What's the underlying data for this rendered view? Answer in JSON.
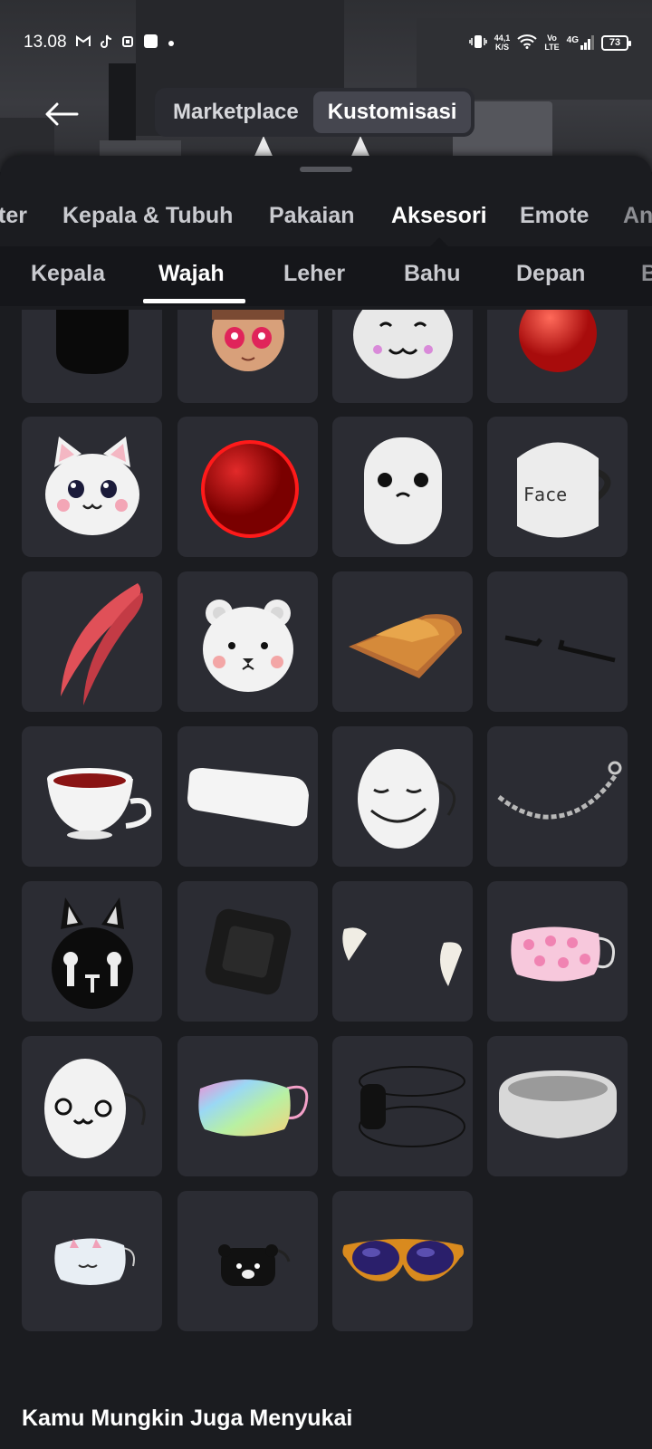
{
  "status_bar": {
    "time": "13.08",
    "net_speed_value": "44,1",
    "net_speed_unit": "K/S",
    "volte_top": "Vo",
    "volte_bottom": "LTE",
    "network": "4G",
    "battery": "73"
  },
  "top_nav": {
    "tabs": [
      {
        "label": "Marketplace",
        "active": false
      },
      {
        "label": "Kustomisasi",
        "active": true
      }
    ]
  },
  "category_tabs": [
    {
      "label": "Karakter",
      "visible_text": "ter",
      "active": false
    },
    {
      "label": "Kepala & Tubuh",
      "active": false
    },
    {
      "label": "Pakaian",
      "active": false
    },
    {
      "label": "Aksesori",
      "active": true
    },
    {
      "label": "Emote",
      "active": false
    },
    {
      "label": "An",
      "active": false
    }
  ],
  "sub_tabs": [
    {
      "label": "Kepala",
      "active": false
    },
    {
      "label": "Wajah",
      "active": true
    },
    {
      "label": "Leher",
      "active": false
    },
    {
      "label": "Bahu",
      "active": false
    },
    {
      "label": "Depan",
      "active": false
    },
    {
      "label": "B",
      "active": false
    }
  ],
  "items": [
    {
      "icon": "black-hood-icon"
    },
    {
      "icon": "anime-face-icon"
    },
    {
      "icon": "white-cute-face-icon"
    },
    {
      "icon": "red-nose-icon"
    },
    {
      "icon": "white-cat-mask-icon"
    },
    {
      "icon": "red-clown-nose-icon"
    },
    {
      "icon": "marshmallow-face-icon"
    },
    {
      "icon": "face-mug-mask-icon",
      "text": "Face"
    },
    {
      "icon": "red-feather-icon"
    },
    {
      "icon": "white-bear-mask-icon"
    },
    {
      "icon": "toast-icon"
    },
    {
      "icon": "black-brows-icon"
    },
    {
      "icon": "teacup-icon"
    },
    {
      "icon": "bandage-icon"
    },
    {
      "icon": "smile-egg-mask-icon"
    },
    {
      "icon": "silver-chain-icon"
    },
    {
      "icon": "black-bunny-mask-icon"
    },
    {
      "icon": "black-patch-icon"
    },
    {
      "icon": "vampire-fangs-icon"
    },
    {
      "icon": "pink-face-mask-icon"
    },
    {
      "icon": "owo-egg-mask-icon"
    },
    {
      "icon": "rainbow-face-mask-icon"
    },
    {
      "icon": "black-eye-patch-icon"
    },
    {
      "icon": "white-visor-icon"
    },
    {
      "icon": "bunny-face-mask-icon"
    },
    {
      "icon": "bear-eye-patch-icon"
    },
    {
      "icon": "orange-sunglasses-icon"
    }
  ],
  "section_title": "Kamu Mungkin Juga Menyukai"
}
